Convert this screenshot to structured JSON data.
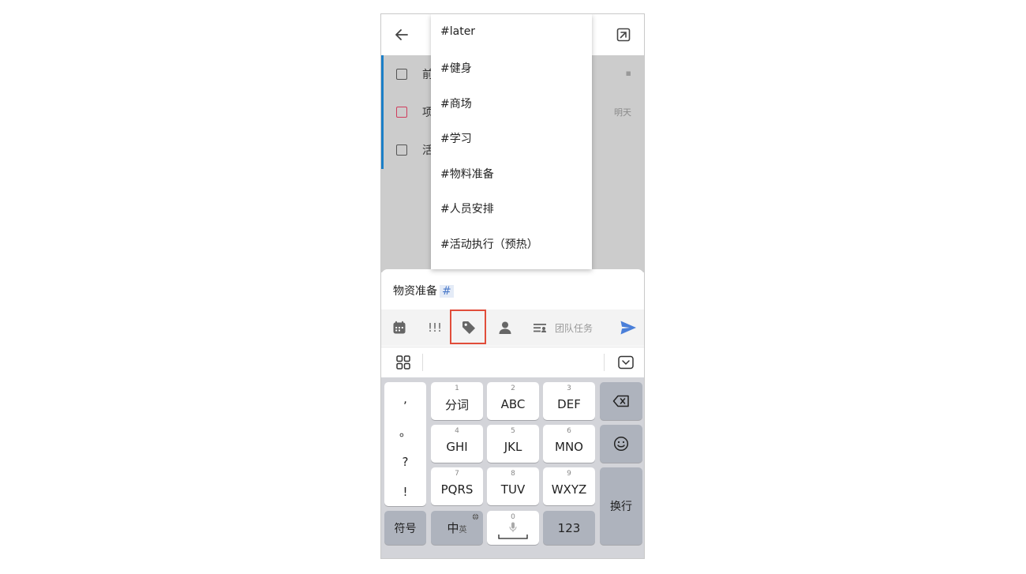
{
  "header": {
    "back_icon": "arrow-left-icon",
    "expand_icon": "expand-icon"
  },
  "tasks": [
    {
      "title": "前",
      "right": "▪"
    },
    {
      "title": "项",
      "right": "明天"
    },
    {
      "title": "活",
      "right": ""
    }
  ],
  "tag_dropdown": {
    "items": [
      "#later",
      "#健身",
      "#商场",
      "#学习",
      "#物料准备",
      "#人员安排",
      "#活动执行（预热）"
    ]
  },
  "input": {
    "text": "物资准备",
    "hash": "#"
  },
  "toolbar": {
    "priority_label": "!!!",
    "team_task_label": "团队任务",
    "colors": {
      "send": "#4a7fd9",
      "highlight": "#e14d3a"
    }
  },
  "keyboard": {
    "punct": [
      ",",
      "。",
      "?",
      "!"
    ],
    "row1": [
      {
        "num": "1",
        "label": "分词"
      },
      {
        "num": "2",
        "label": "ABC"
      },
      {
        "num": "3",
        "label": "DEF"
      }
    ],
    "row2": [
      {
        "num": "4",
        "label": "GHI"
      },
      {
        "num": "5",
        "label": "JKL"
      },
      {
        "num": "6",
        "label": "MNO"
      }
    ],
    "row3": [
      {
        "num": "7",
        "label": "PQRS"
      },
      {
        "num": "8",
        "label": "TUV"
      },
      {
        "num": "9",
        "label": "WXYZ"
      }
    ],
    "symbols_label": "符号",
    "lang_label": "中",
    "lang_sub": "英",
    "space_num": "0",
    "num123_label": "123",
    "enter_label": "换行"
  }
}
